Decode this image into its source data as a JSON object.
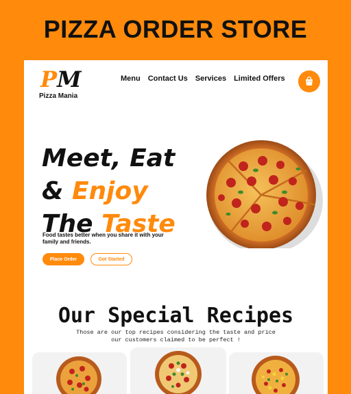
{
  "banner": {
    "title": "PIZZA ORDER STORE"
  },
  "header": {
    "logo_mark_p": "P",
    "logo_mark_m": "M",
    "logo_text": "Pizza Mania",
    "nav": [
      "Menu",
      "Contact Us",
      "Services",
      "Limited Offers"
    ],
    "cart_icon": "shopping-bag-icon"
  },
  "hero": {
    "line1": "Meet, Eat",
    "line2_prefix": "& ",
    "line2_accent": "Enjoy",
    "line3_prefix": "The ",
    "line3_accent": "Taste",
    "subtitle": "Food tastes better when you share it with your family and friends.",
    "primary_button": "Place Order",
    "secondary_button": "Got Started"
  },
  "recipes": {
    "title": "Our Special Recipes",
    "subtitle_line1": "Those are our top recipes considering the taste and price",
    "subtitle_line2": "our customers claimed to be perfect !"
  },
  "colors": {
    "accent": "#ff8a0c",
    "text": "#111111",
    "card_bg": "#f2f2f2"
  }
}
